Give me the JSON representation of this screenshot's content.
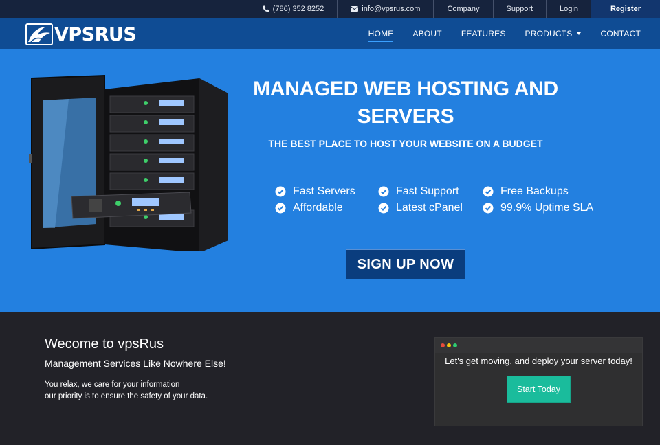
{
  "topbar": {
    "phone": "(786) 352 8252",
    "email": "info@vpsrus.com",
    "links": [
      "Company",
      "Support",
      "Login"
    ],
    "register": "Register"
  },
  "logo": {
    "text": "VPSRUS"
  },
  "nav": {
    "items": [
      {
        "label": "HOME",
        "active": true
      },
      {
        "label": "ABOUT"
      },
      {
        "label": "FEATURES"
      },
      {
        "label": "PRODUCTS",
        "has_dropdown": true
      },
      {
        "label": "CONTACT"
      }
    ]
  },
  "hero": {
    "title_line1": "MANAGED WEB HOSTING AND",
    "title_line2": "SERVERS",
    "subtitle": "THE BEST PLACE TO HOST YOUR WEBSITE ON A BUDGET",
    "features": [
      "Fast Servers",
      "Fast Support",
      "Free Backups",
      "Affordable",
      "Latest cPanel",
      "99.9% Uptime SLA"
    ],
    "cta": "SIGN UP NOW"
  },
  "welcome": {
    "title": "Wecome to vpsRus",
    "subtitle": "Management Services Like Nowhere Else!",
    "line1": "You relax, we care for your information",
    "line2": "our priority is to ensure the safety of your data."
  },
  "deploy_card": {
    "text": "Let's get moving, and deploy your server today!",
    "button": "Start Today"
  },
  "colors": {
    "topbar": "#16233d",
    "nav": "#0f4c94",
    "hero": "#2380e0",
    "cta": "#0a3d7e",
    "start_button": "#1abc9c",
    "dark": "#222228"
  },
  "icons": [
    "phone-icon",
    "envelope-icon",
    "check-circle-icon",
    "caret-down-icon"
  ]
}
